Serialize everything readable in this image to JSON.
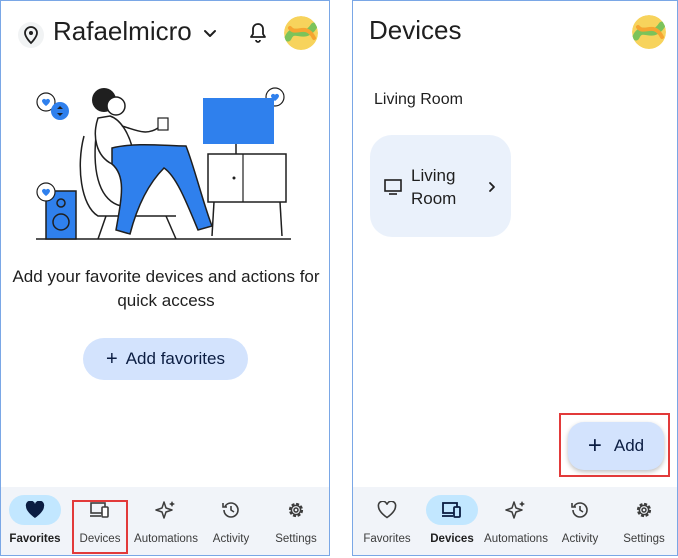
{
  "left_screen": {
    "header": {
      "home_name": "Rafaelmicro"
    },
    "empty_state": {
      "message": "Add your favorite devices and actions for quick access",
      "add_button_label": "Add favorites"
    }
  },
  "right_screen": {
    "header": {
      "title": "Devices"
    },
    "room_section_title": "Living Room",
    "room_card_label": "Living Room",
    "fab_label": "Add"
  },
  "bottom_nav": {
    "items": [
      {
        "label": "Favorites",
        "icon": "heart-icon"
      },
      {
        "label": "Devices",
        "icon": "devices-icon"
      },
      {
        "label": "Automations",
        "icon": "sparkle-icon"
      },
      {
        "label": "Activity",
        "icon": "history-icon"
      },
      {
        "label": "Settings",
        "icon": "gear-icon"
      }
    ],
    "left_active": "Favorites",
    "right_active": "Devices"
  },
  "colors": {
    "accent_container": "#d3e3fd",
    "active_nav_pill": "#c2e7ff",
    "card_background": "#eaf1fb",
    "nav_background": "#f1f4f9",
    "highlight_red": "#e23a3a",
    "illustration_blue": "#2f80ed"
  }
}
